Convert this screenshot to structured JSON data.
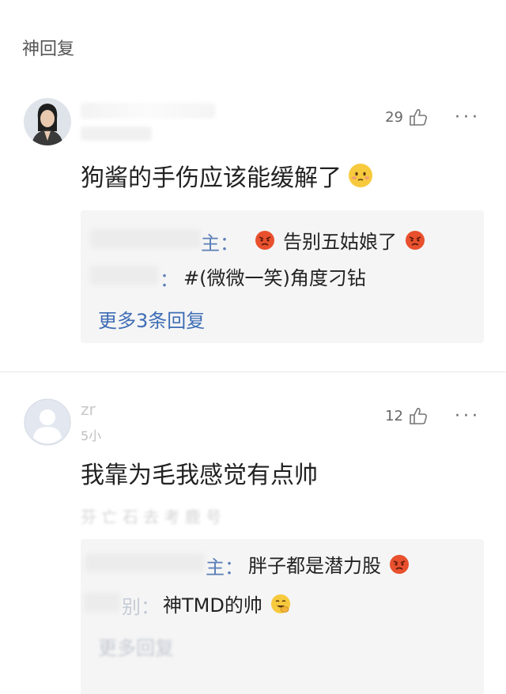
{
  "section": {
    "title": "神回复"
  },
  "comments": [
    {
      "author": "",
      "time": "",
      "likes": "29",
      "text": "狗酱的手伤应该能缓解了",
      "text_emoji": "shy-face-emoji",
      "replies": [
        {
          "name_suffix": "主：",
          "text": "告别五姑娘了",
          "emojis": [
            "angry-face-emoji",
            "angry-face-emoji"
          ]
        },
        {
          "name_suffix": "：",
          "text": "#(微微一笑)角度刁钻",
          "emojis": []
        }
      ],
      "more_replies": "更多3条回复"
    },
    {
      "author": "zr",
      "time": "5小",
      "likes": "12",
      "text": "我靠为毛我感觉有点帅",
      "faded_row": "芬  亡  石  去  考  鹿  号",
      "replies": [
        {
          "name_suffix": "主：",
          "text": "胖子都是潜力股",
          "emojis": [
            "angry-face-emoji"
          ]
        },
        {
          "name_suffix": "别：",
          "text": "神TMD的帅",
          "emojis": [
            "laughing-cover-face-emoji"
          ]
        }
      ],
      "more_replies": "更多回复"
    }
  ],
  "icons": {
    "like": "like-hand-icon",
    "more": "more-dots-icon"
  },
  "colors": {
    "link": "#3e6db5",
    "reply_bg": "#f5f5f5",
    "emoji_yellow": "#f7c93d",
    "emoji_angry": "#e8502e"
  }
}
